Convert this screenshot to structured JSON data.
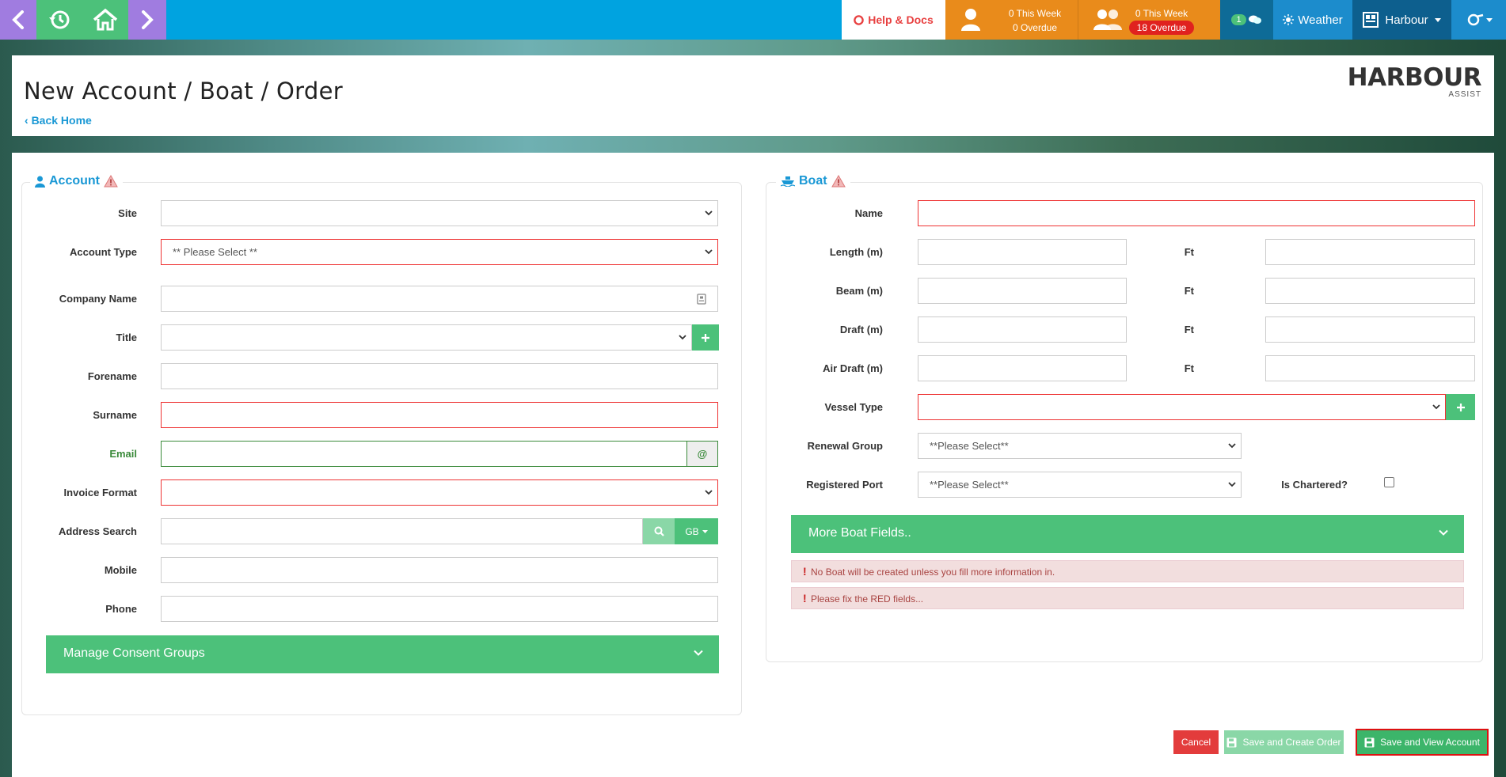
{
  "topbar": {
    "help_label": "Help & Docs",
    "activity_1": {
      "line1": "0 This Week",
      "line2": "0 Overdue"
    },
    "activity_2": {
      "line1": "0 This Week",
      "line2": "18 Overdue"
    },
    "toggle_badge": "1",
    "weather_label": "Weather",
    "harbour_label": "Harbour"
  },
  "header": {
    "title": "New Account / Boat / Order",
    "back_link": "Back Home",
    "logo_main": "HARBOUR",
    "logo_sub": "ASSIST"
  },
  "account": {
    "legend": "Account",
    "fields": {
      "site": {
        "label": "Site",
        "value": ""
      },
      "account_type": {
        "label": "Account Type",
        "value": "** Please Select **"
      },
      "company_name": {
        "label": "Company Name",
        "value": ""
      },
      "title": {
        "label": "Title",
        "value": ""
      },
      "forename": {
        "label": "Forename",
        "value": ""
      },
      "surname": {
        "label": "Surname",
        "value": ""
      },
      "email": {
        "label": "Email",
        "value": "",
        "addon": "@"
      },
      "invoice_format": {
        "label": "Invoice Format",
        "value": ""
      },
      "address_search": {
        "label": "Address Search",
        "value": "",
        "country": "GB"
      },
      "mobile": {
        "label": "Mobile",
        "value": ""
      },
      "phone": {
        "label": "Phone",
        "value": ""
      }
    },
    "consent_accordion": "Manage Consent Groups"
  },
  "boat": {
    "legend": "Boat",
    "fields": {
      "name": {
        "label": "Name",
        "value": ""
      },
      "length": {
        "label": "Length (m)",
        "ft_label": "Ft"
      },
      "beam": {
        "label": "Beam (m)",
        "ft_label": "Ft"
      },
      "draft": {
        "label": "Draft (m)",
        "ft_label": "Ft"
      },
      "air_draft": {
        "label": "Air Draft (m)",
        "ft_label": "Ft"
      },
      "vessel_type": {
        "label": "Vessel Type",
        "value": ""
      },
      "renewal_group": {
        "label": "Renewal Group",
        "value": "**Please Select**"
      },
      "registered_port": {
        "label": "Registered Port",
        "value": "**Please Select**"
      },
      "is_chartered": {
        "label": "Is Chartered?",
        "checked": false
      }
    },
    "more_fields_accordion": "More Boat Fields..",
    "alerts": [
      "No Boat will be created unless you fill more information in.",
      "Please fix the RED fields..."
    ]
  },
  "actions": {
    "cancel": "Cancel",
    "save_create_order": "Save and Create Order",
    "save_view_account": "Save and View Account"
  },
  "colors": {
    "topbar_blue": "#00a3e0",
    "nav_purple": "#a07ce0",
    "nav_green": "#4cc17a",
    "activity_orange": "#e98b1b",
    "accent_blue": "#1a98d5",
    "danger_red": "#e33c3c"
  },
  "icons": [
    "back-arrow-icon",
    "history-icon",
    "home-icon",
    "forward-arrow-icon",
    "lifebuoy-icon",
    "user-icon",
    "users-group-icon",
    "toggle-switch-icon",
    "sun-icon",
    "harbour-map-icon",
    "user-settings-icon",
    "person-icon",
    "boat-icon",
    "warning-icon",
    "id-card-icon",
    "search-icon",
    "floppy-disk-icon",
    "chevron-down-icon",
    "plus-icon"
  ]
}
